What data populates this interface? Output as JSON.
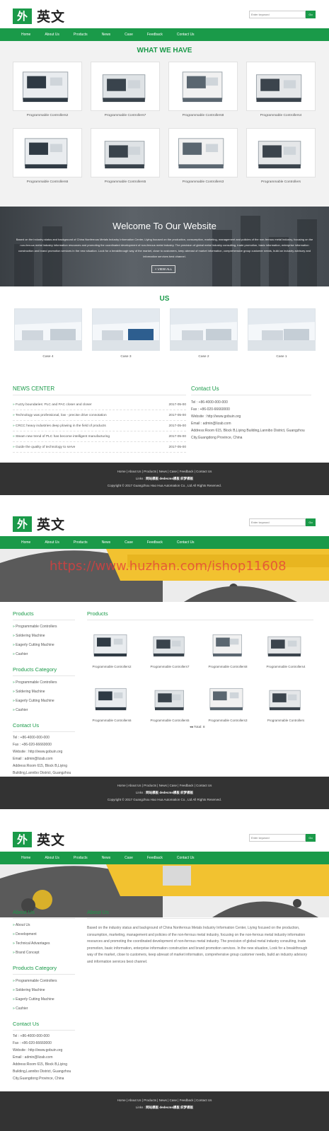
{
  "logo": {
    "mark": "外",
    "text": "英文"
  },
  "search": {
    "placeholder": "Enter keyword",
    "button": "Go"
  },
  "nav": [
    "Home",
    "About Us",
    "Products",
    "News",
    "Case",
    "Feedback",
    "Contact Us"
  ],
  "home": {
    "what_title": "WHAT WE HAVE",
    "products": [
      "Programmable Controllers2",
      "Programmable Controllers7",
      "Programmable Controllers8",
      "Programmable Controllers4",
      "Programmable Controllers6",
      "Programmable Controllers5",
      "Programmable Controllers3",
      "Programmable Controllers"
    ],
    "welcome_title": "Welcome To Our Website",
    "welcome_text": "Based on the industry status and background of China Nonferrous Metals Industry Information Center, Liying focused on the production, consumption, marketing, management and policies of the non-ferrous metal industry, focusing on the non-ferrous metal industry information resources and promoting the coordinated development of non-ferrous metal industry. The precision of global metal industry consulting, trade promotion, basic information, enterprise information construction and brand promotion services in the new situation. Look for a breakthrough way of the market, close to customers, keep abreast of market information, comprehensive group customer needs, build an industry advisory and information services best channel.",
    "view_all": "+ VIEW ALL",
    "us_title": "US",
    "cases": [
      "Case 4",
      "Case 3",
      "Case 2",
      "Case 1"
    ],
    "news_title": "NEWS CENTER",
    "news": [
      {
        "title": "Fuzzy boundaries: PLC and PAC closer and closer",
        "date": "2017-05-00"
      },
      {
        "title": "Technology was professional, low - precise drive connotation",
        "date": "2017-05-00"
      },
      {
        "title": "CRCC heavy industries deep plowing in the field of products",
        "date": "2017-05-00"
      },
      {
        "title": "Steam new trend of PLC has become intelligent manufacturing",
        "date": "2017-05-00"
      },
      {
        "title": "Guide the quality of technology to serve",
        "date": "2017-05-00"
      }
    ],
    "contact_title": "Contact Us"
  },
  "contact": {
    "tel": "Tel : +86-4000-000-000",
    "fax": "Fax : +86-020-66660000",
    "web": "Website : http://www.gobuin.org",
    "email": "Email : admin@lizab.com",
    "address": "Address:Room 615, Block B,Liying Building,Lannibo District, Guangzhou City,Guangdong Province, China"
  },
  "footer": {
    "links": "Home | About Us | Products | News | Case | Feedback | Contact Us",
    "links_label": "Links :",
    "links_items": "网站模板   dedecms模板   织梦模板",
    "copyright": "Copyright © 2017 Guangzhou Hao Hua Automation Co., Ltd All Rights Reserved."
  },
  "watermark": "https://www.huzhan.com/ishop11608",
  "products_page": {
    "sidebar_title": "Products",
    "sidebar_items": [
      "Programmable Controllers",
      "Soldering Machine",
      "Eagerly Cutting Machine",
      "Cashier"
    ],
    "category_title": "Products Category",
    "category_items": [
      "Programmable Controllers",
      "Soldering Machine",
      "Eagerly Cutting Machine",
      "Cashier"
    ],
    "contact_title": "Contact Us",
    "main_title": "Products",
    "products": [
      "Programmable Controllers2",
      "Programmable Controllers7",
      "Programmable Controllers8",
      "Programmable Controllers4",
      "Programmable Controllers6",
      "Programmable Controllers5",
      "Programmable Controllers3",
      "Programmable Controllers"
    ],
    "pager": "◂◂ Total: 8"
  },
  "about_page": {
    "sidebar_title": "About Us",
    "sidebar_items": [
      "About Us",
      "Development",
      "Technical Advantages",
      "Brand Concept"
    ],
    "category_title": "Products Category",
    "category_items": [
      "Programmable Controllers",
      "Soldering Machine",
      "Eagerly Cutting Machine",
      "Cashier"
    ],
    "contact_title": "Contact Us",
    "main_title": "About Us",
    "text": "Based on the industry status and background of China Nonferrous Metals Industry Information Center, Liying focused on the production, consumption, marketing, management and policies of the non-ferrous metal industry, focusing on the non-ferrous metal industry information resources and promoting the coordinated development of non-ferrous metal industry. The precision of global metal industry consulting, trade promotion, basic information, enterprise information construction and brand promotion services. In the new situation, Look for a breakthrough way of the market, close to customers, keep abreast of market information, comprehensive group customer needs, build an industry advisory and information services best channel."
  },
  "colors": {
    "brand": "#1a9a49",
    "footer": "#333333"
  }
}
